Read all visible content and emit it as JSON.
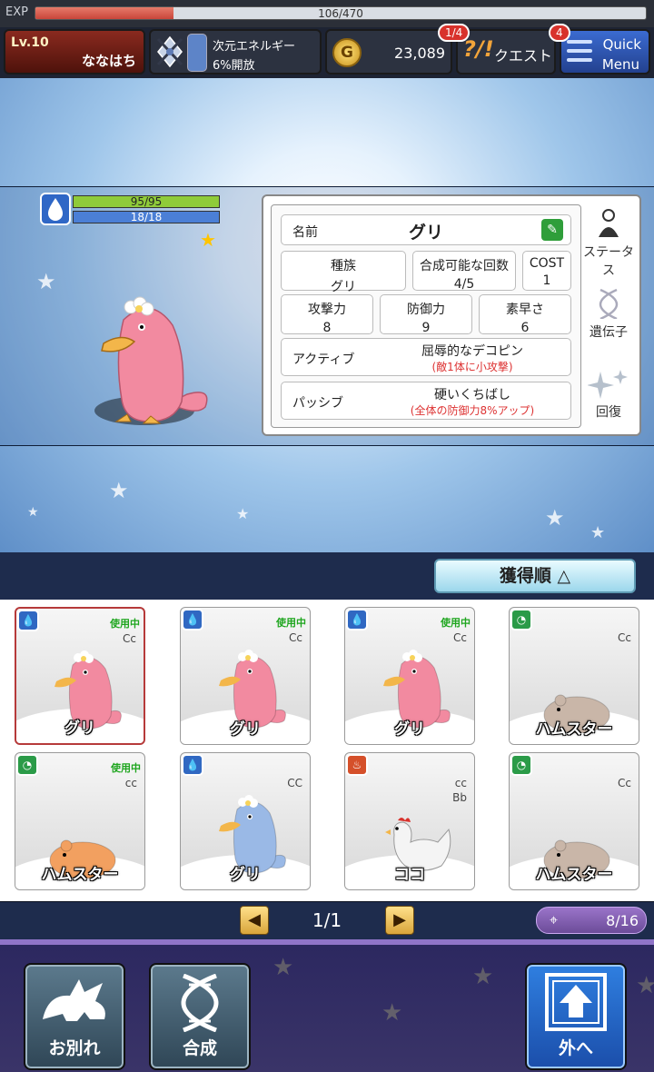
{
  "exp": {
    "label": "EXP",
    "text": "106/470",
    "fraction": 0.2255
  },
  "player": {
    "level": "Lv.10",
    "name": "ななはち"
  },
  "energy": {
    "label": "次元エネルギー",
    "status": "6%開放",
    "icon": "crystal-sword-icon"
  },
  "gold": {
    "symbol": "G",
    "amount": "23,089"
  },
  "quest": {
    "mark": "?/!",
    "label": "クエスト",
    "badge": "1/4"
  },
  "menu": {
    "line1": "Quick",
    "line2": "Menu",
    "badge": "4"
  },
  "monster": {
    "hp_text": "95/95",
    "mp_text": "18/18",
    "rarity_star": "★",
    "element_icon": "water-drop-icon",
    "color": "#f28aa0"
  },
  "status": {
    "name_label": "名前",
    "name_value": "グリ",
    "edit_icon": "pencil-icon",
    "species_label": "種族",
    "species_value": "グリ",
    "fusion_label": "合成可能な回数",
    "fusion_value": "4/5",
    "cost_label": "COST",
    "cost_value": "1",
    "attack_label": "攻撃力",
    "attack_value": "8",
    "defense_label": "防御力",
    "defense_value": "9",
    "speed_label": "素早さ",
    "speed_value": "6",
    "active_label": "アクティブ",
    "active_name": "屈辱的なデコピン",
    "active_desc": "(敵1体に小攻撃)",
    "passive_label": "パッシブ",
    "passive_name": "硬いくちばし",
    "passive_desc": "(全体の防御力8%アップ)"
  },
  "tabs": [
    {
      "label": "ステータス",
      "icon": "person-icon"
    },
    {
      "label": "遺伝子",
      "icon": "dna-icon"
    },
    {
      "label": "回復",
      "icon": "sparkle-icon"
    }
  ],
  "sort": {
    "label": "獲得順 △"
  },
  "cards": [
    {
      "name": "グリ",
      "element": "water",
      "in_use": "使用中",
      "grade1": "Cc",
      "grade2": "",
      "creature": "pink-platypus",
      "color": "#f28aa0"
    },
    {
      "name": "グリ",
      "element": "water",
      "in_use": "使用中",
      "grade1": "Cc",
      "grade2": "",
      "creature": "pink-platypus",
      "color": "#f28aa0"
    },
    {
      "name": "グリ",
      "element": "water",
      "in_use": "使用中",
      "grade1": "Cc",
      "grade2": "",
      "creature": "pink-platypus",
      "color": "#f28aa0"
    },
    {
      "name": "ハムスター",
      "element": "wind",
      "in_use": "",
      "grade1": "Cc",
      "grade2": "",
      "creature": "hamster",
      "color": "#c9b6a8"
    },
    {
      "name": "ハムスター",
      "element": "wind",
      "in_use": "使用中",
      "grade1": "cc",
      "grade2": "",
      "creature": "hamster",
      "color": "#f2a060"
    },
    {
      "name": "グリ",
      "element": "water",
      "in_use": "",
      "grade1": "CC",
      "grade2": "",
      "creature": "blue-platypus",
      "color": "#9ab9e6"
    },
    {
      "name": "ココ",
      "element": "fire",
      "in_use": "",
      "grade1": "cc",
      "grade2": "Bb",
      "creature": "chicken",
      "color": "#f4f4f4"
    },
    {
      "name": "ハムスター",
      "element": "wind",
      "in_use": "",
      "grade1": "Cc",
      "grade2": "",
      "creature": "hamster",
      "color": "#c9b6a8"
    }
  ],
  "pager": {
    "prev": "◀",
    "next": "▶",
    "page": "1/1",
    "capacity": "8/16",
    "capacity_icon": "target-icon"
  },
  "actions": {
    "farewell": "お別れ",
    "fusion": "合成",
    "exit": "外へ"
  }
}
